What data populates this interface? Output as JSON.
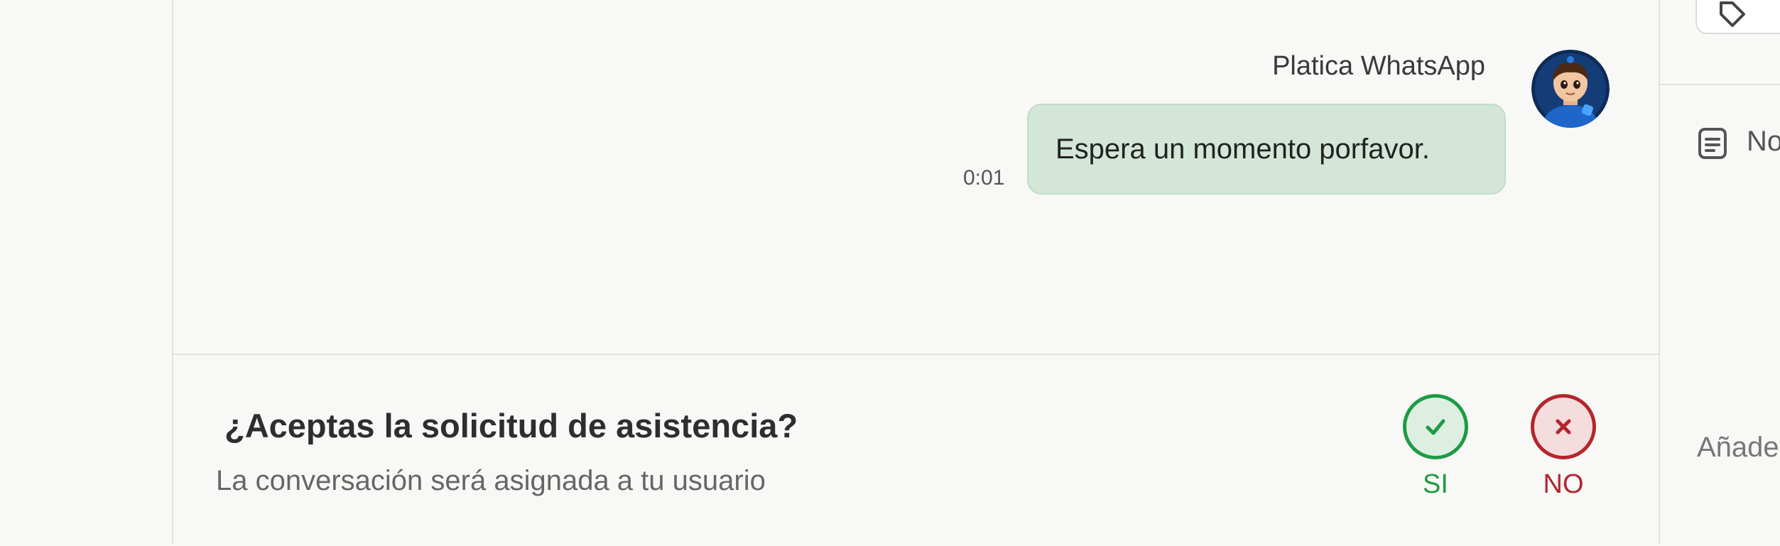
{
  "chat": {
    "sender_name": "Platica WhatsApp",
    "message_text": "Espera un momento porfavor.",
    "message_time": "0:01",
    "avatar_icon": "boy-avatar-icon"
  },
  "request": {
    "question": "¿Aceptas la solicitud de asistencia?",
    "subtext": "La conversación será asignada a tu usuario",
    "yes_label": "SI",
    "no_label": "NO"
  },
  "right_panel": {
    "note_label": "No",
    "add_label": "Añade"
  },
  "colors": {
    "bubble": "#d3e6d8",
    "yes": "#1f9a44",
    "no": "#b3262d",
    "background": "#f8f8f6"
  }
}
